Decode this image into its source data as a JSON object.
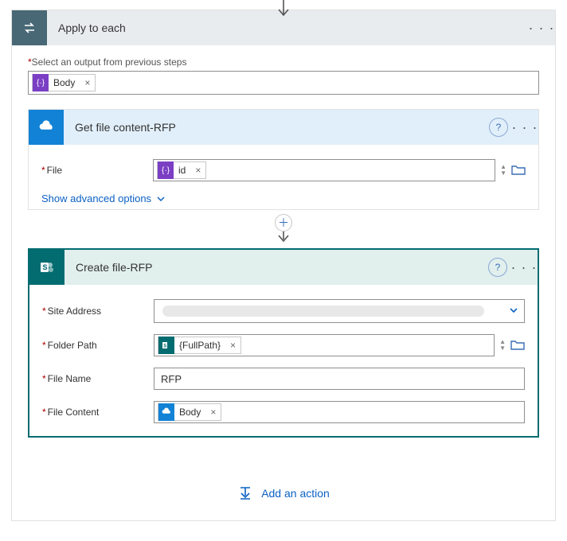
{
  "applyToEach": {
    "title": "Apply to each",
    "selectLabel": "Select an output from previous steps",
    "bodyToken": "Body"
  },
  "getFile": {
    "title": "Get file content-RFP",
    "fileLabel": "File",
    "idToken": "id",
    "advanced": "Show advanced options"
  },
  "createFile": {
    "title": "Create file-RFP",
    "siteLabel": "Site Address",
    "folderLabel": "Folder Path",
    "folderToken": "{FullPath}",
    "fileNameLabel": "File Name",
    "fileNameValue": "RFP",
    "fileContentLabel": "File Content",
    "bodyToken": "Body"
  },
  "addAction": "Add an action"
}
